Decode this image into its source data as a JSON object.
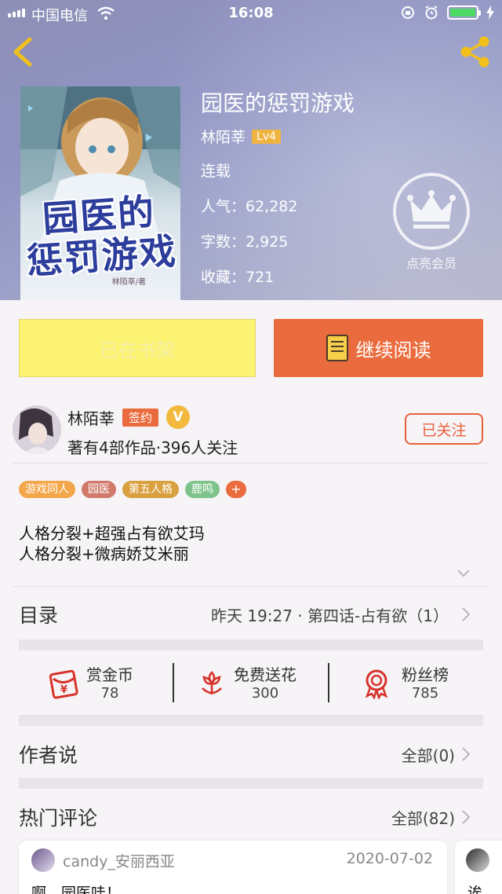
{
  "status_bar": {
    "carrier": "中国电信",
    "time": "16:08"
  },
  "book": {
    "title": "园医的惩罚游戏",
    "cover_title": "园医的惩罚游戏",
    "cover_title_line1": "园医的",
    "cover_title_line2": "惩罚游戏",
    "cover_author": "林陌莘/著",
    "author": "林陌莘",
    "level": "Lv4",
    "status": "连载",
    "popularity": "人气：62,282",
    "word_count": "字数：2,925",
    "favorites": "收藏：721"
  },
  "vip": {
    "label": "点亮会员",
    "icon": "crown-icon"
  },
  "buttons": {
    "on_shelf": "已在书架",
    "continue_reading": "继续阅读"
  },
  "author_info": {
    "name": "林陌莘",
    "sign_badge": "签约",
    "verified": "V",
    "stats": "著有4部作品·396人关注",
    "follow_label": "已关注"
  },
  "tags": [
    {
      "label": "游戏同人",
      "color": "#f3a64a"
    },
    {
      "label": "园医",
      "color": "#d17a6c"
    },
    {
      "label": "第五人格",
      "color": "#d9a03f"
    },
    {
      "label": "鹿鸣",
      "color": "#7ec48a"
    }
  ],
  "tag_add": "+",
  "description": {
    "line1": "人格分裂+超强占有欲艾玛",
    "line2": "人格分裂+微病娇艾米丽"
  },
  "catalog": {
    "title": "目录",
    "latest": "昨天 19:27 · 第四话-占有欲（1）"
  },
  "actions": [
    {
      "label": "赏金币",
      "count": "78",
      "icon": "red-envelope-icon"
    },
    {
      "label": "免费送花",
      "count": "300",
      "icon": "flower-icon"
    },
    {
      "label": "粉丝榜",
      "count": "785",
      "icon": "medal-icon"
    }
  ],
  "author_says": {
    "title": "作者说",
    "all": "全部(0)"
  },
  "hot_comments": {
    "title": "热门评论",
    "all": "全部(82)",
    "items": [
      {
        "user": "candy_安丽西亚",
        "date": "2020-07-02",
        "text": "啊，园医哇！"
      },
      {
        "text": "诶"
      }
    ]
  },
  "colors": {
    "accent": "#ea6b3d",
    "shelf_button": "#fbf371",
    "header_tint": "#8f93c2"
  }
}
